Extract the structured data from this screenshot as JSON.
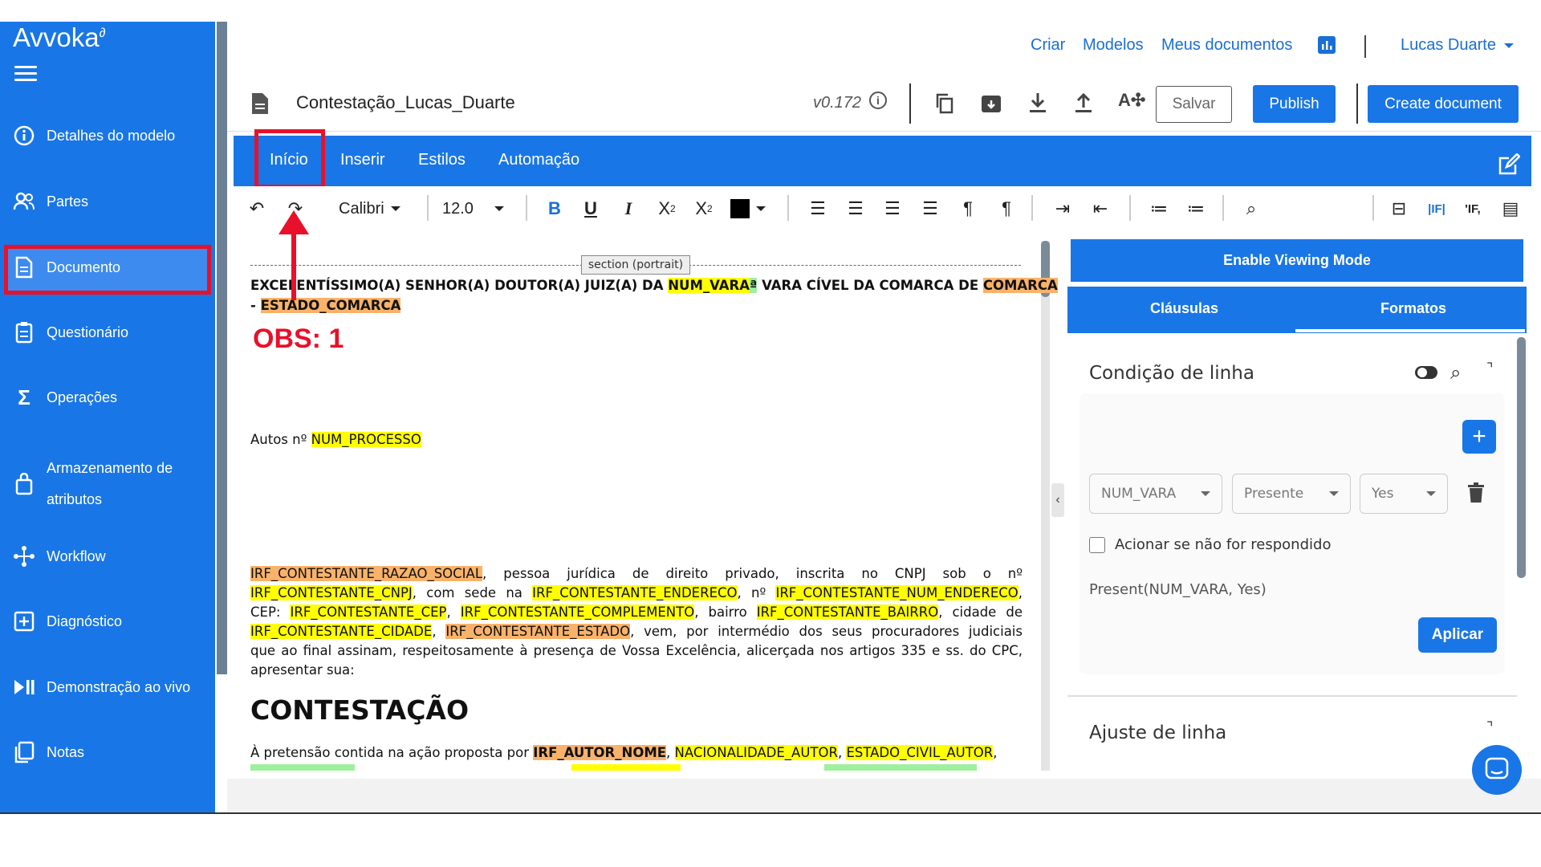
{
  "sidebar": {
    "logo": "Avvoka",
    "items": [
      {
        "label": "Detalhes do modelo"
      },
      {
        "label": "Partes"
      },
      {
        "label": "Documento"
      },
      {
        "label": "Questionário"
      },
      {
        "label": "Operações"
      },
      {
        "label": "Armazenamento de",
        "label2": "atributos"
      },
      {
        "label": "Workflow"
      },
      {
        "label": "Diagnóstico"
      },
      {
        "label": "Demonstração ao vivo"
      },
      {
        "label": "Notas"
      }
    ]
  },
  "topnav": {
    "criar": "Criar",
    "modelos": "Modelos",
    "meus_documentos": "Meus documentos",
    "user": "Lucas Duarte"
  },
  "doc_header": {
    "title": "Contestação_Lucas_Duarte",
    "version": "v0.172",
    "salvar": "Salvar",
    "publish": "Publish",
    "create": "Create document"
  },
  "ribbon": {
    "tabs": [
      "Início",
      "Inserir",
      "Estilos",
      "Automação"
    ],
    "font": "Calibri",
    "size": "12.0"
  },
  "document": {
    "section_tag": "section (portrait)",
    "line1": [
      "EXCELENTÍSSIMO(A) SENHOR(A) DOUTOR(A) JUIZ(A) DA ",
      "NUM_VARA",
      "ª",
      " VARA CÍVEL DA COMARCA DE ",
      "COMARCA"
    ],
    "line2": [
      "- ",
      "ESTADO_COMARCA"
    ],
    "autos": [
      "Autos nº ",
      "NUM_PROCESSO"
    ],
    "para": {
      "l1": [
        "IRF_CONTESTANTE_RAZAO_SOCIAL",
        ", pessoa jurídica de direito privado, inscrita no CNPJ sob o nº"
      ],
      "l2": [
        "IRF_CONTESTANTE_CNPJ",
        ", com sede na ",
        "IRF_CONTESTANTE_ENDERECO",
        ", nº ",
        "IRF_CONTESTANTE_NUM_ENDERECO",
        ","
      ],
      "l3": [
        "CEP: ",
        "IRF_CONTESTANTE_CEP",
        ", ",
        "IRF_CONTESTANTE_COMPLEMENTO",
        ", bairro ",
        "IRF_CONTESTANTE_BAIRRO",
        ", cidade de"
      ],
      "l4": [
        "IRF_CONTESTANTE_CIDADE",
        ", ",
        "IRF_CONTESTANTE_ESTADO",
        ", vem, por intermédio dos seus procuradores judiciais"
      ],
      "l5": "que ao final assinam, respeitosamente à presença de Vossa Excelência, alicerçada nos artigos 335 e ss. do CPC,",
      "l6": "apresentar sua:"
    },
    "heading": "CONTESTAÇÃO",
    "last": [
      "À pretensão contida na ação proposta por ",
      "IRF_AUTOR_NOME",
      ", ",
      "NACIONALIDADE_AUTOR",
      ", ",
      "ESTADO_CIVIL_AUTOR",
      ","
    ]
  },
  "annotation": {
    "obs": "OBS: 1"
  },
  "right_panel": {
    "view_mode": "Enable Viewing Mode",
    "tab_clausulas": "Cláusulas",
    "tab_formatos": "Formatos",
    "condition_title": "Condição de linha",
    "select1": "NUM_VARA",
    "select2": "Presente",
    "select3": "Yes",
    "checkbox_label": "Acionar se não for respondido",
    "expression": "Present(NUM_VARA, Yes)",
    "apply": "Aplicar",
    "adjust_title": "Ajuste de linha"
  }
}
